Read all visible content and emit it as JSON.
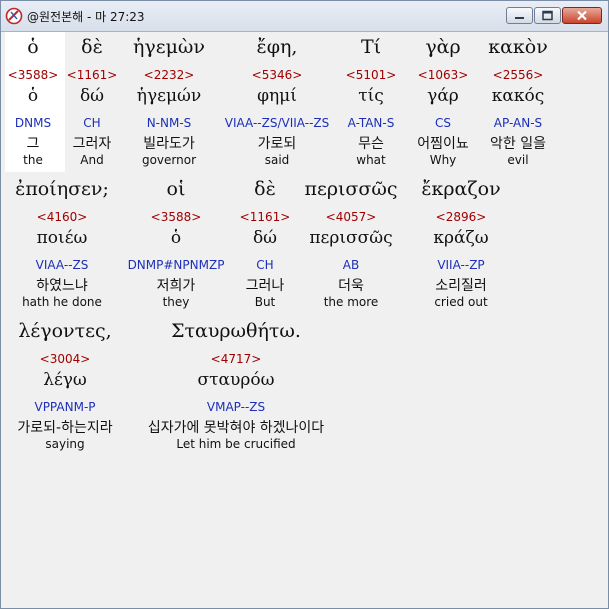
{
  "window": {
    "title": "@원전본해 - 마 27:23",
    "buttons": {
      "minimize": "minimize-icon",
      "maximize": "maximize-icon",
      "close": "close-icon"
    }
  },
  "lines": [
    {
      "words": [
        {
          "greek": "ὁ",
          "strong": "<3588>",
          "lemma": "ὁ",
          "morph": "DNMS",
          "korean": "그",
          "english": "the"
        },
        {
          "greek": "δὲ",
          "strong": "<1161>",
          "lemma": "δώ",
          "morph": "CH",
          "korean": "그러자",
          "english": "And"
        },
        {
          "greek": "ἡγεμὼν",
          "strong": "<2232>",
          "lemma": "ἡγεμών",
          "morph": "N-NM-S",
          "korean": "빌라도가",
          "english": "governor"
        },
        {
          "greek": "ἔφη,",
          "strong": "<5346>",
          "lemma": "φημί",
          "morph": "VIAA--ZS/VIIA--ZS",
          "korean": "가로되",
          "english": "said"
        },
        {
          "greek": "Τί",
          "strong": "<5101>",
          "lemma": "τίς",
          "morph": "A-TAN-S",
          "korean": "무슨",
          "english": "what"
        },
        {
          "greek": "γὰρ",
          "strong": "<1063>",
          "lemma": "γάρ",
          "morph": "CS",
          "korean": "어찜이뇨",
          "english": "Why"
        },
        {
          "greek": "κακὸν",
          "strong": "<2556>",
          "lemma": "κακός",
          "morph": "AP-AN-S",
          "korean": "악한 일을",
          "english": "evil"
        }
      ]
    },
    {
      "words": [
        {
          "greek": "ἐποίησεν;",
          "strong": "<4160>",
          "lemma": "ποιέω",
          "morph": "VIAA--ZS",
          "korean": "하였느냐",
          "english": "hath he done"
        },
        {
          "greek": "οἱ",
          "strong": "<3588>",
          "lemma": "ὁ",
          "morph": "DNMP#NPNMZP",
          "korean": "저희가",
          "english": "they"
        },
        {
          "greek": "δὲ",
          "strong": "<1161>",
          "lemma": "δώ",
          "morph": "CH",
          "korean": "그러나",
          "english": "But"
        },
        {
          "greek": "περισσῶς",
          "strong": "<4057>",
          "lemma": "περισσῶς",
          "morph": "AB",
          "korean": "더욱",
          "english": "the more"
        },
        {
          "greek": "ἔκραζον",
          "strong": "<2896>",
          "lemma": "κράζω",
          "morph": "VIIA--ZP",
          "korean": "소리질러",
          "english": "cried out"
        }
      ]
    },
    {
      "words": [
        {
          "greek": "λέγοντες,",
          "strong": "<3004>",
          "lemma": "λέγω",
          "morph": "VPPANM-P",
          "korean": "가로되-하는지라",
          "english": "saying"
        },
        {
          "greek": "Σταυρωθήτω.",
          "strong": "<4717>",
          "lemma": "σταυρόω",
          "morph": "VMAP--ZS",
          "korean": "십자가에 못박혀야 하겠나이다",
          "english": "Let him be crucified"
        }
      ]
    }
  ]
}
